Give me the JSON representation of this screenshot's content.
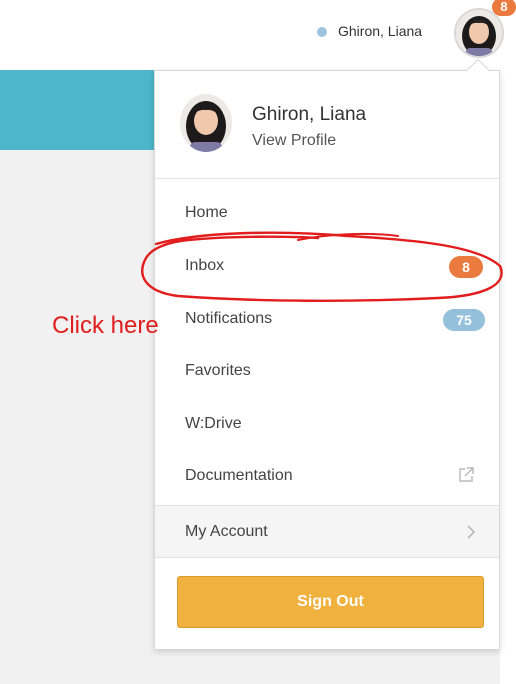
{
  "header": {
    "user_name": "Ghiron, Liana",
    "notification_badge": "8",
    "status_color": "#9ec4dd",
    "brand_color": "#4db6c8"
  },
  "profile": {
    "name": "Ghiron, Liana",
    "view_profile": "View Profile"
  },
  "menu": {
    "items": [
      {
        "label": "Home"
      },
      {
        "label": "Inbox",
        "badge": "8",
        "badge_color": "#ea7a3e"
      },
      {
        "label": "Notifications",
        "badge": "75",
        "badge_color": "#95c0db"
      },
      {
        "label": "Favorites"
      },
      {
        "label": "W:Drive"
      },
      {
        "label": "Documentation",
        "icon": "external-link-icon"
      }
    ],
    "account": {
      "label": "My Account",
      "icon": "chevron-right-icon"
    }
  },
  "sign_out": {
    "label": "Sign Out",
    "color": "#f0b13e"
  },
  "annotation": {
    "text": "Click here",
    "color": "#e11d1d"
  }
}
